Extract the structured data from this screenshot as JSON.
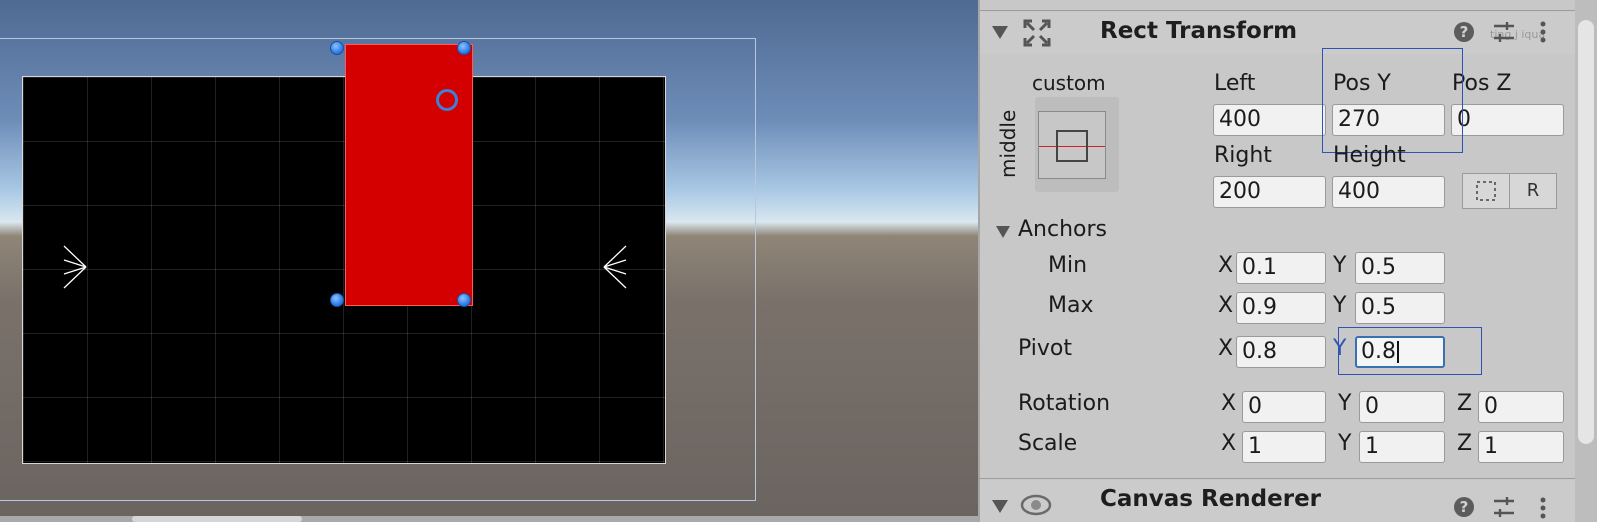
{
  "colors": {
    "selection_red": "#d40000",
    "handle_blue": "#2f7fe6",
    "highlight_box": "#2f52b8"
  },
  "rect_transform": {
    "title": "Rect Transform",
    "preset_label_top": "custom",
    "preset_label_side": "middle",
    "fields": {
      "left": {
        "label": "Left",
        "value": "400"
      },
      "pos_y": {
        "label": "Pos Y",
        "value": "270"
      },
      "pos_z": {
        "label": "Pos Z",
        "value": "0"
      },
      "right": {
        "label": "Right",
        "value": "200"
      },
      "height": {
        "label": "Height",
        "value": "400"
      }
    },
    "blueprint_button_icon": "dotted-rect-icon",
    "raw_button_label": "R",
    "watermark": "ting j iqua"
  },
  "anchors": {
    "label": "Anchors",
    "min": {
      "label": "Min",
      "x_label": "X",
      "x": "0.1",
      "y_label": "Y",
      "y": "0.5"
    },
    "max": {
      "label": "Max",
      "x_label": "X",
      "x": "0.9",
      "y_label": "Y",
      "y": "0.5"
    }
  },
  "pivot": {
    "label": "Pivot",
    "x_label": "X",
    "x": "0.8",
    "y_label": "Y",
    "y": "0.8"
  },
  "rotation": {
    "label": "Rotation",
    "x_label": "X",
    "x": "0",
    "y_label": "Y",
    "y": "0",
    "z_label": "Z",
    "z": "0"
  },
  "scale": {
    "label": "Scale",
    "x_label": "X",
    "x": "1",
    "y_label": "Y",
    "y": "1",
    "z_label": "Z",
    "z": "1"
  },
  "canvas_renderer": {
    "title": "Canvas Renderer"
  }
}
